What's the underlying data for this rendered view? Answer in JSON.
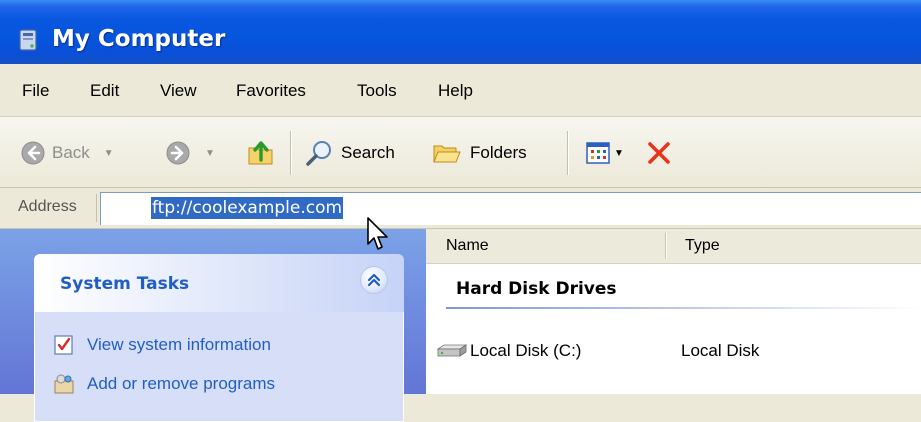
{
  "window": {
    "title": "My Computer",
    "colors": {
      "title_bar": "#0555dd",
      "chrome": "#ece9d8",
      "task_pane": "#6f8ede",
      "link": "#215dc6",
      "selection": "#316ac5"
    }
  },
  "menu": {
    "items": [
      "File",
      "Edit",
      "View",
      "Favorites",
      "Tools",
      "Help"
    ]
  },
  "toolbar": {
    "back_label": "Back",
    "search_label": "Search",
    "folders_label": "Folders",
    "icons": [
      "back-arrow-icon",
      "forward-arrow-icon",
      "up-folder-icon",
      "search-icon",
      "folders-icon",
      "views-icon",
      "delete-icon"
    ]
  },
  "address": {
    "label": "Address",
    "value": "ftp://coolexample.com"
  },
  "task_pane": {
    "title": "System Tasks",
    "links": [
      {
        "label": "View system information",
        "icon": "system-info-icon"
      },
      {
        "label": "Add or remove programs",
        "icon": "add-remove-programs-icon"
      }
    ]
  },
  "file_list": {
    "columns": [
      "Name",
      "Type"
    ],
    "group_title": "Hard Disk Drives",
    "rows": [
      {
        "name": "Local Disk (C:)",
        "type": "Local Disk",
        "icon": "hard-drive-icon"
      }
    ]
  }
}
